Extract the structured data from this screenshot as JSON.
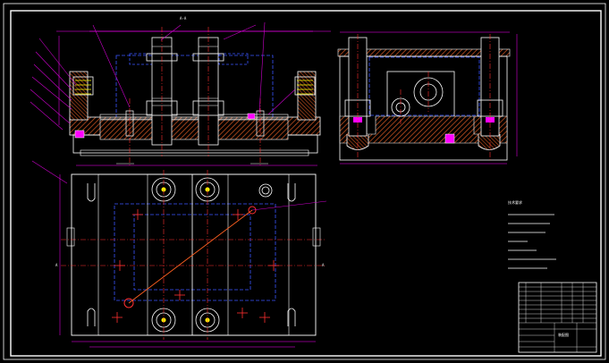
{
  "drawing": {
    "section_label": "A-A",
    "section_marker_left": "A",
    "section_marker_right": "A",
    "background": "#000000",
    "colors": {
      "frame": "#ffffff",
      "outline": "#ffffff",
      "hatch": "#c0501f",
      "hidden": "#3a54ff",
      "center": "#ff3030",
      "dimension": "#ff00ff",
      "leader": "#cc00cc",
      "callout": "#00ffff",
      "yellow": "#ffff00",
      "green": "#22ff22"
    },
    "title_block": {
      "text": "装配图"
    },
    "notes_heading": "技术要求"
  }
}
